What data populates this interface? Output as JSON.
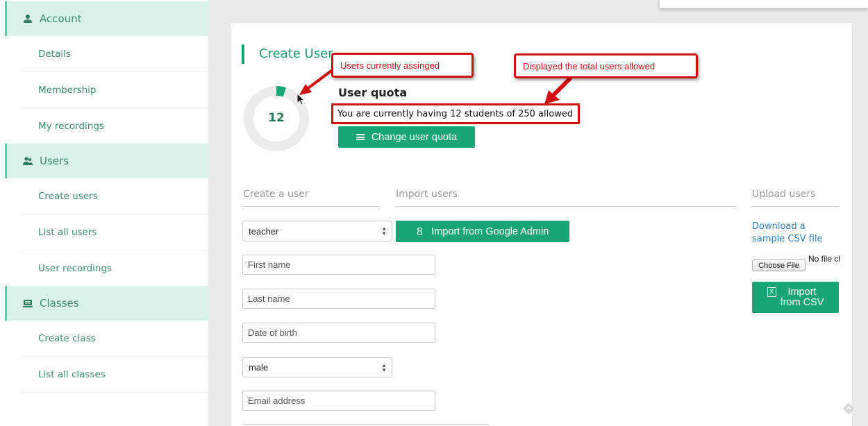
{
  "sidebar": {
    "sections": [
      {
        "label": "Account",
        "icon": "user-icon"
      },
      {
        "label": "Users",
        "icon": "users-icon"
      },
      {
        "label": "Classes",
        "icon": "classes-icon"
      }
    ],
    "items": [
      {
        "label": "Details"
      },
      {
        "label": "Membership"
      },
      {
        "label": "My recordings"
      },
      {
        "label": "Create users"
      },
      {
        "label": "List all users"
      },
      {
        "label": "User recordings"
      },
      {
        "label": "Create class"
      },
      {
        "label": "List all classes"
      }
    ]
  },
  "main": {
    "title": "Create User",
    "quota": {
      "assigned": "12",
      "allowed": 250,
      "title": "User quota",
      "text": "You are currently having 12 students of 250 allowed",
      "change_button": "Change user quota"
    },
    "annotations": {
      "assigned": "Users currently assinged",
      "total": "Displayed the total users allowed"
    },
    "tabs": {
      "create": "Create a user",
      "import": "Import users",
      "upload": "Upload users"
    },
    "form": {
      "role_value": "teacher",
      "first_name_placeholder": "First name",
      "last_name_placeholder": "Last name",
      "dob_placeholder": "Date of birth",
      "gender_value": "male",
      "email_placeholder": "Email address"
    },
    "import": {
      "google_button": "Import from Google Admin"
    },
    "upload": {
      "sample_link": "Download a sample CSV file",
      "choose_file": "Choose File",
      "no_file": "No file chosen",
      "import_csv_line1": "Import",
      "import_csv_line2": "from CSV"
    }
  },
  "colors": {
    "accent": "#1aa576",
    "sidebar_section_bg": "#d9f3ea",
    "annotation_red": "#d20f0f",
    "link": "#2a7fbf"
  }
}
